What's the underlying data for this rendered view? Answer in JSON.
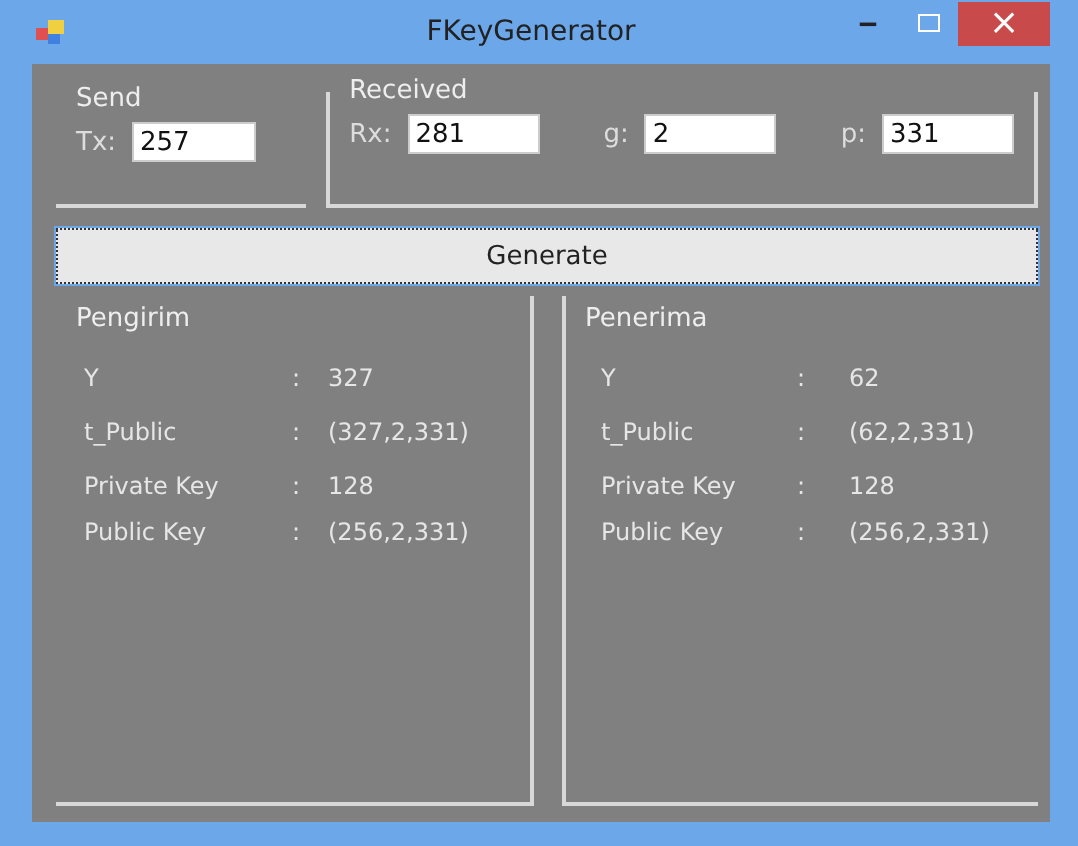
{
  "window": {
    "title": "FKeyGenerator",
    "minimize": "‒",
    "close": "×"
  },
  "send": {
    "title": "Send",
    "fields": [
      {
        "label": "Tx:",
        "value": "257"
      }
    ]
  },
  "received": {
    "title": "Received",
    "fields": [
      {
        "label": "Rx:",
        "value": "281"
      },
      {
        "label": "g:",
        "value": "2"
      },
      {
        "label": "p:",
        "value": "331"
      }
    ]
  },
  "generate_button": "Generate",
  "panels": [
    {
      "title": "Pengirim",
      "rows": [
        {
          "label": "Y",
          "separator": ":",
          "value": "327"
        },
        {
          "label": "t_Public",
          "separator": ":",
          "value": "(327,2,331)"
        },
        {
          "label": "Private Key",
          "separator": ":",
          "value": "128"
        },
        {
          "label": "Public Key",
          "separator": ":",
          "value": "(256,2,331)"
        }
      ]
    },
    {
      "title": "Penerima",
      "rows": [
        {
          "label": "Y",
          "separator": ":",
          "value": "62"
        },
        {
          "label": "t_Public",
          "separator": ":",
          "value": "(62,2,331)"
        },
        {
          "label": "Private Key",
          "separator": ":",
          "value": "128"
        },
        {
          "label": "Public Key",
          "separator": ":",
          "value": "(256,2,331)"
        }
      ]
    }
  ]
}
